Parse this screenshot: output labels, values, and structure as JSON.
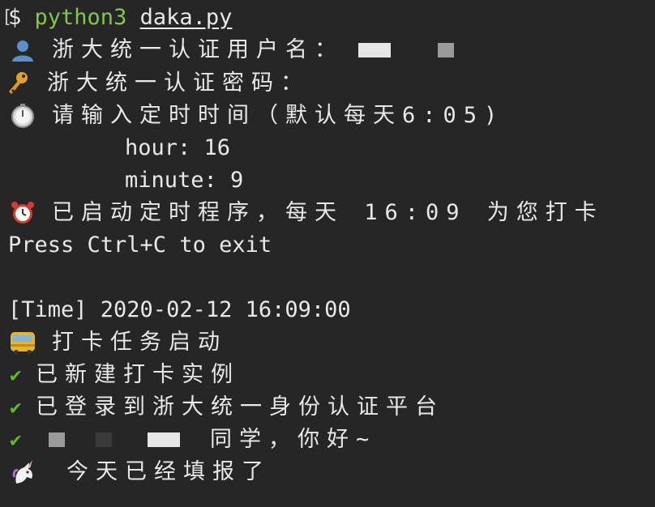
{
  "colors": {
    "background": "#262626",
    "text": "#e8e8e8",
    "command": "#7ec850",
    "check": "#5fb830"
  },
  "prompt": {
    "open_bracket": "[",
    "symbol": "$",
    "command": "python3",
    "argument": "daka.py"
  },
  "lines": {
    "username_label": "浙大统一认证用户名：",
    "password_label": "浙大统一认证密码：",
    "schedule_prompt": "请输入定时时间（默认每天6:05)",
    "hour": "hour: 16",
    "minute": "minute: 9",
    "scheduled": "已启动定时程序，每天 16:09 为您打卡",
    "press_exit": "Press Ctrl+C to exit",
    "time_stamp": "[Time] 2020-02-12 16:09:00",
    "task_start": "打卡任务启动",
    "new_instance": "已新建打卡实例",
    "logged_in": "已登录到浙大统一身份认证平台",
    "greeting": "同学，你好~",
    "already_done": "今天已经填报了"
  },
  "icons": {
    "user": "bust-silhouette-icon",
    "key": "key-icon",
    "timer": "stopwatch-icon",
    "alarm": "alarm-clock-icon",
    "bus": "bus-icon",
    "check": "check-mark-icon",
    "unicorn": "unicorn-icon"
  },
  "check_glyph": "✔"
}
